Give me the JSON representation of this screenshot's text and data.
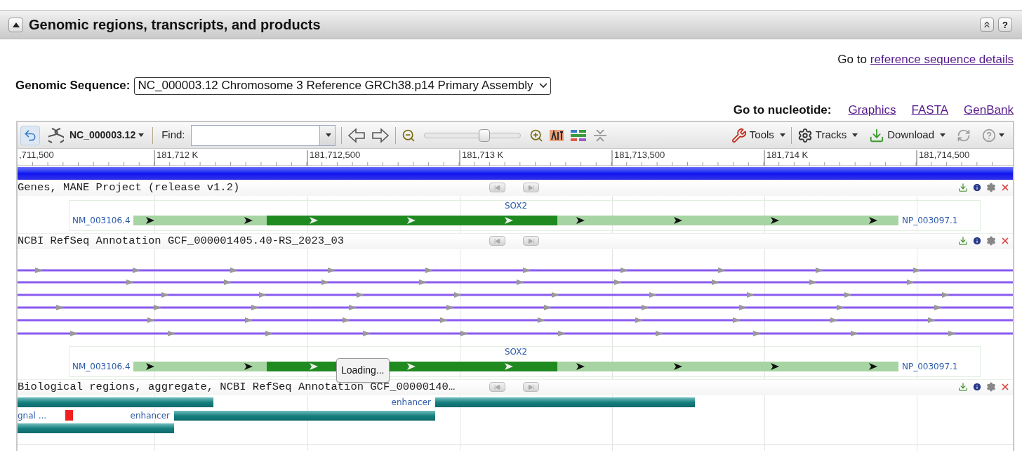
{
  "section": {
    "title": "Genomic regions, transcripts, and products",
    "expanded": true,
    "help": "?"
  },
  "reference_link": {
    "prefix": "Go to",
    "link": "reference sequence details"
  },
  "genomic_sequence": {
    "label": "Genomic Sequence:",
    "value": "NC_000003.12 Chromosome 3 Reference GRCh38.p14 Primary Assembly"
  },
  "nucleotide_links": {
    "label": "Go to nucleotide:",
    "links": [
      "Graphics",
      "FASTA",
      "GenBank"
    ]
  },
  "viewer": {
    "toolbar": {
      "sequence": "NC_000003.12",
      "find_label": "Find:",
      "zoom": {
        "level": 0.63
      },
      "tools": "Tools",
      "tracks": "Tracks",
      "download": "Download"
    },
    "ruler": [
      ",711,500",
      "181,712 K",
      "181,712,500",
      "181,713 K",
      "181,713,500",
      "181,714 K",
      "181,714,500"
    ],
    "tracks": [
      {
        "title": "Genes, MANE Project (release v1.2)",
        "content": [
          {
            "kind": "gene_model",
            "gene": "SOX2",
            "transcript": "NM_003106.4",
            "protein": "NP_003097.1"
          }
        ]
      },
      {
        "title": "NCBI RefSeq Annotation GCF_000001405.40-RS_2023_03",
        "content": [
          {
            "kind": "transcript_lines"
          },
          {
            "kind": "gene_model",
            "gene": "SOX2",
            "transcript": "NM_003106.4",
            "protein": "NP_003097.1"
          }
        ]
      },
      {
        "title": "Biological regions, aggregate, NCBI RefSeq Annotation GCF_00000140…",
        "content": [
          {
            "kind": "regions",
            "rows": [
              [
                {
                  "kind": "region"
                },
                {
                  "kind": "region",
                  "label": "enhancer"
                }
              ],
              [
                {
                  "kind": "marker",
                  "label": "gnal ..."
                },
                {
                  "kind": "region",
                  "label": "enhancer"
                }
              ],
              [
                {
                  "kind": "region"
                }
              ]
            ]
          }
        ]
      }
    ],
    "loading": "Loading..."
  }
}
